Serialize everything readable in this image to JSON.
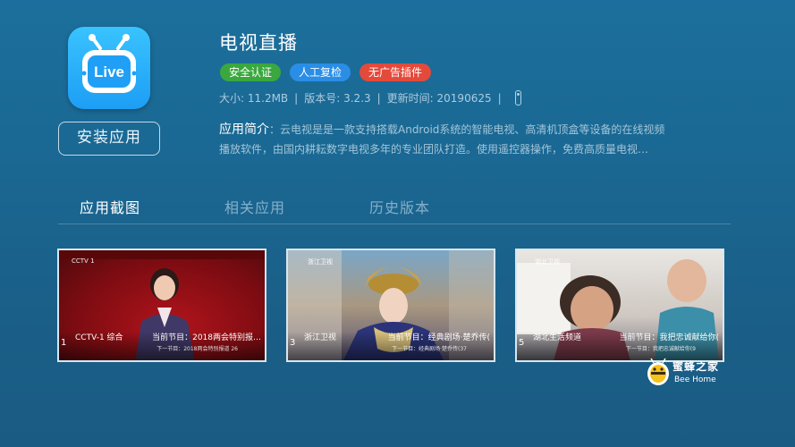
{
  "app": {
    "icon_label": "Live",
    "title": "电视直播",
    "install_label": "安装应用",
    "badges": [
      {
        "label": "安全认证",
        "color": "#3aa83e"
      },
      {
        "label": "人工复检",
        "color": "#2a8ee6"
      },
      {
        "label": "无广告插件",
        "color": "#e34a3b"
      }
    ],
    "meta": {
      "size": "大小: 11.2MB",
      "version": "版本号: 3.2.3",
      "updated": "更新时间: 20190625",
      "sep": "|"
    },
    "description": {
      "label": "应用简介",
      "text": "：云电视是是一款支持搭载Android系统的智能电视、高清机顶盒等设备的在线视频播放软件，由国内耕耘数字电视多年的专业团队打造。使用遥控器操作，免费高质量电视…"
    }
  },
  "tabs": [
    {
      "label": "应用截图",
      "active": true
    },
    {
      "label": "相关应用",
      "active": false
    },
    {
      "label": "历史版本",
      "active": false
    }
  ],
  "screenshots": [
    {
      "num": "1",
      "logo": "CCTV 1",
      "channel": "CCTV-1 综合",
      "program": "当前节目：2018两会特别报…",
      "next": "下一节目：2018两会特别报道 26"
    },
    {
      "num": "3",
      "logo": "浙江卫视",
      "channel": "浙江卫视",
      "program": "当前节目：经典剧场·楚乔传(",
      "next": "下一节目：经典剧场·楚乔传(37"
    },
    {
      "num": "5",
      "logo": "湖北卫视",
      "channel": "湖北生活频道",
      "program": "当前节目：我把忠诚献给你(",
      "next": "下一节目：我把忠诚献给你(9"
    }
  ],
  "watermark": {
    "title": "蜜蜂之家",
    "subtitle": "Bee Home"
  }
}
